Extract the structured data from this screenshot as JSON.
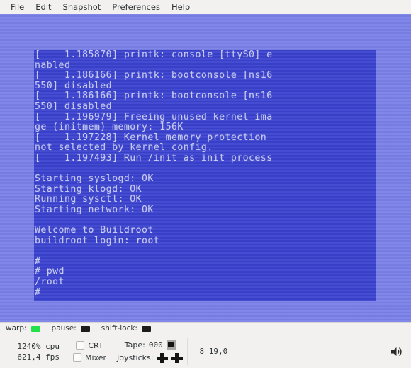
{
  "window": {
    "menu": [
      {
        "label": "File"
      },
      {
        "label": "Edit"
      },
      {
        "label": "Snapshot"
      },
      {
        "label": "Preferences"
      },
      {
        "label": "Help"
      }
    ]
  },
  "screen": {
    "background_color": "#3a42cf",
    "border_color": "#7a80e8",
    "text_color": "#c8ccf2",
    "lines": [
      "[    1.185870] printk: console [ttyS0] e",
      "nabled",
      "[    1.186166] printk: bootconsole [ns16",
      "550] disabled",
      "[    1.186166] printk: bootconsole [ns16",
      "550] disabled",
      "[    1.196979] Freeing unused kernel ima",
      "ge (initmem) memory: 156K",
      "[    1.197228] Kernel memory protection",
      "not selected by kernel config.",
      "[    1.197493] Run /init as init process",
      "",
      "Starting syslogd: OK",
      "Starting klogd: OK",
      "Running sysctl: OK",
      "Starting network: OK",
      "",
      "Welcome to Buildroot",
      "buildroot login: root",
      "",
      "#",
      "# pwd",
      "/root",
      "#"
    ]
  },
  "statusbar": {
    "warp": {
      "label": "warp:",
      "state": "on",
      "color": "#22e04a"
    },
    "pause": {
      "label": "pause:",
      "state": "off",
      "color": "#1c1c1c"
    },
    "shift_lock": {
      "label": "shift-lock:",
      "state": "off",
      "color": "#1c1c1c"
    },
    "performance": {
      "cpu": "1240% cpu",
      "fps": "621,4 fps"
    },
    "crt": {
      "label": "CRT",
      "checked": false
    },
    "mixer": {
      "label": "Mixer",
      "checked": false
    },
    "tape": {
      "label": "Tape:",
      "counter": "000",
      "status_icon": "stop-icon"
    },
    "joysticks": {
      "label": "Joysticks:"
    },
    "drive": {
      "status": "8 19,0"
    },
    "volume": {
      "icon": "speaker-icon"
    }
  }
}
